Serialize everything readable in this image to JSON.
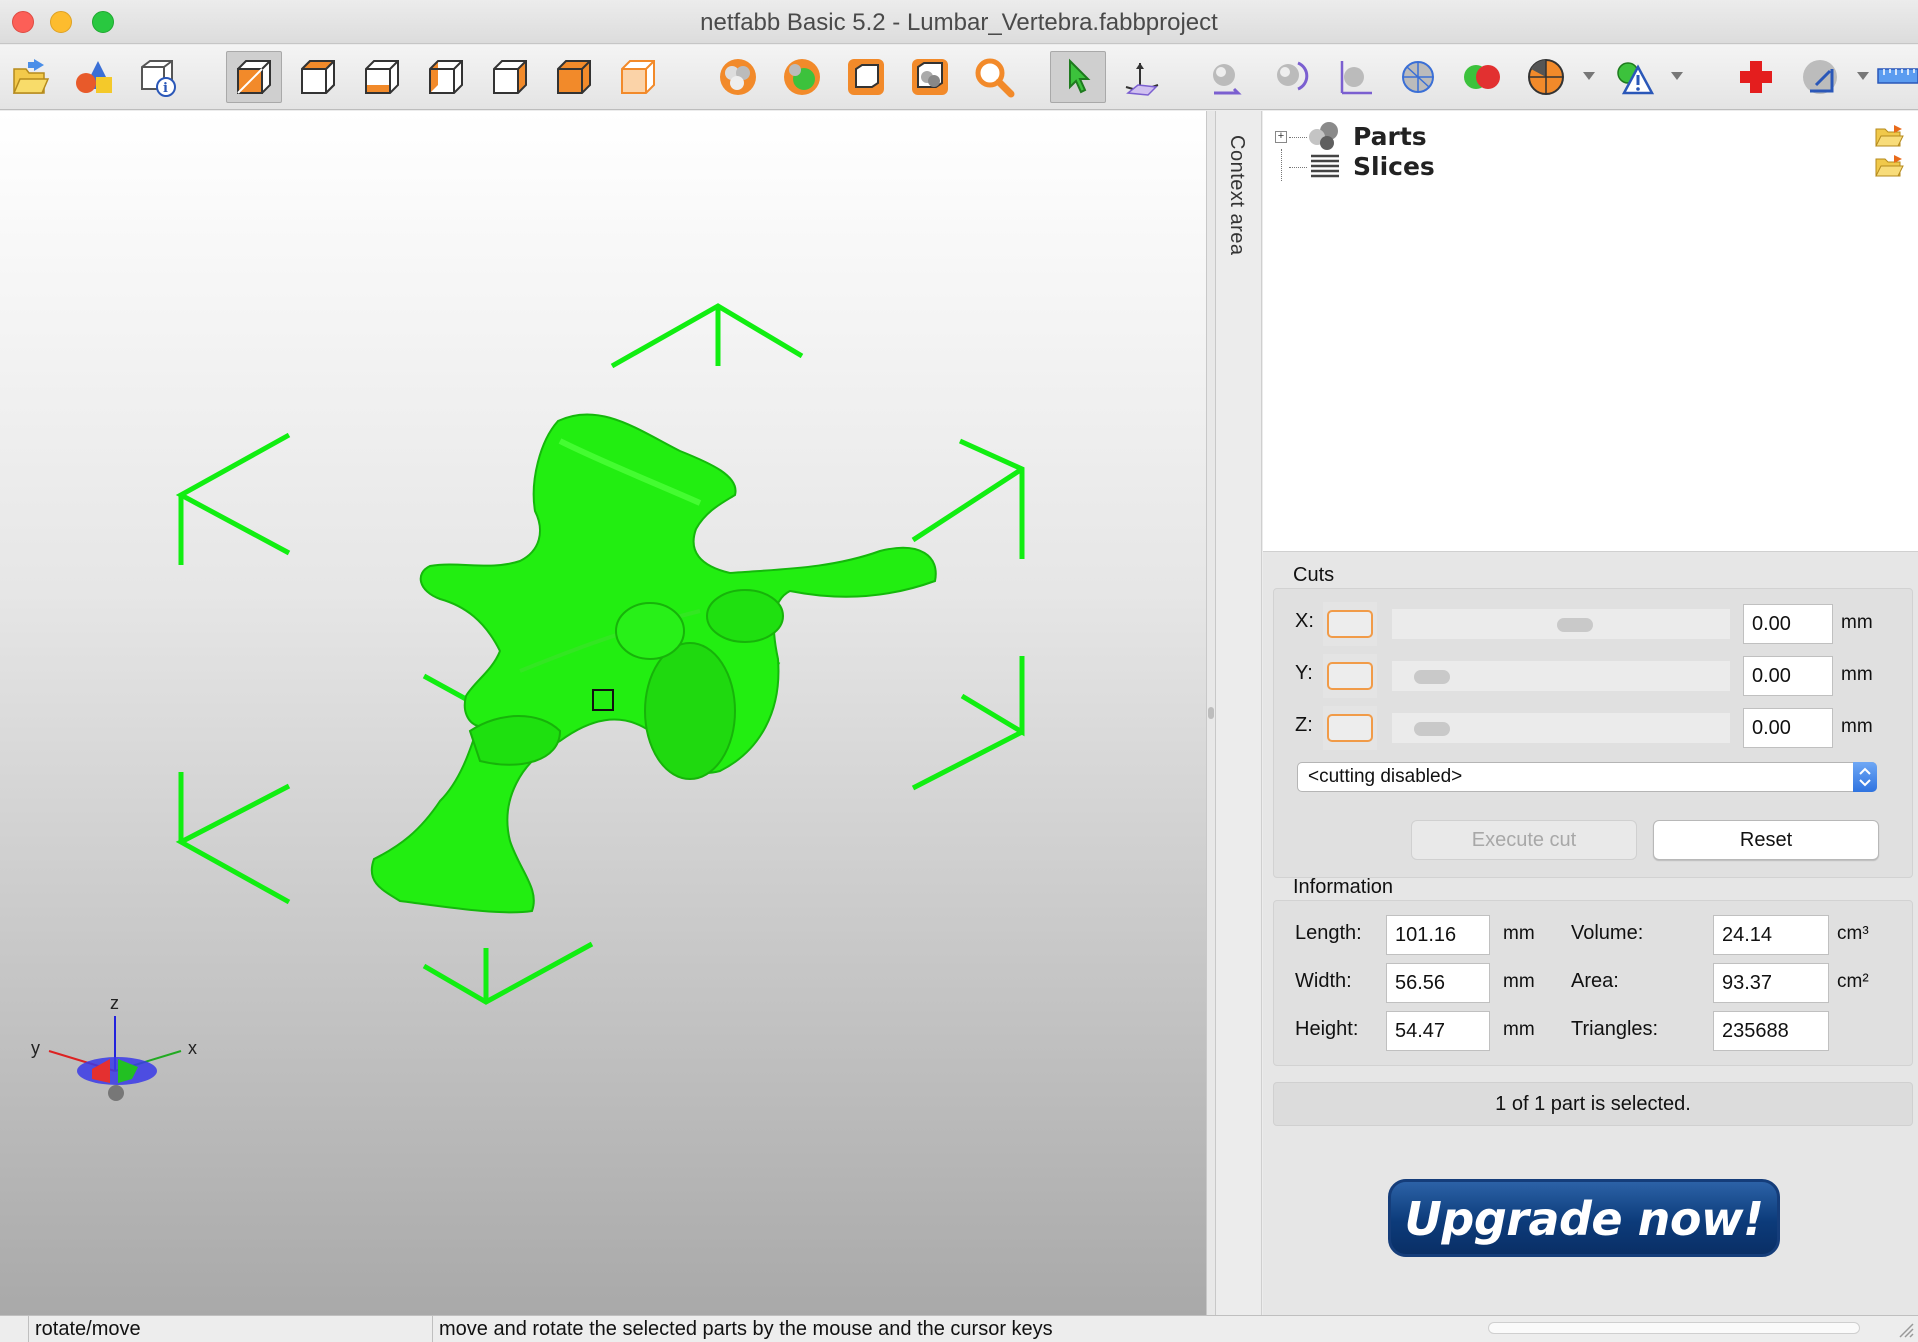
{
  "window": {
    "title": "netfabb Basic 5.2 - Lumbar_Vertebra.fabbproject"
  },
  "toolbar": {
    "buttons": [
      {
        "name": "open-project-button",
        "icon": "open-folder-icon"
      },
      {
        "name": "add-part-button",
        "icon": "shapes-icon"
      },
      {
        "name": "part-info-button",
        "icon": "info-box-icon"
      },
      {
        "name": "view-default-button",
        "icon": "cube-view-icon",
        "active": true
      },
      {
        "name": "view-front-button",
        "icon": "cube-front-icon"
      },
      {
        "name": "view-back-button",
        "icon": "cube-back-icon"
      },
      {
        "name": "view-left-button",
        "icon": "cube-left-icon"
      },
      {
        "name": "view-right-button",
        "icon": "cube-right-icon"
      },
      {
        "name": "view-top-button",
        "icon": "cube-top-icon"
      },
      {
        "name": "view-bottom-button",
        "icon": "cube-bottom-icon"
      },
      {
        "name": "zoom-all-button",
        "icon": "spheres-icon"
      },
      {
        "name": "zoom-selected-button",
        "icon": "sphere-green-icon"
      },
      {
        "name": "zoom-platform-button",
        "icon": "frame-icon"
      },
      {
        "name": "zoom-parts-button",
        "icon": "frame-spheres-icon"
      },
      {
        "name": "zoom-tool-button",
        "icon": "magnifier-icon"
      },
      {
        "name": "select-tool-button",
        "icon": "cursor-icon",
        "active": true
      },
      {
        "name": "move-tool-button",
        "icon": "axes-move-icon"
      },
      {
        "name": "translate-button",
        "icon": "sphere-arrow-icon"
      },
      {
        "name": "rotate-button",
        "icon": "sphere-rotate-icon"
      },
      {
        "name": "scale-button",
        "icon": "sphere-axes-icon"
      },
      {
        "name": "mesh-button",
        "icon": "sphere-mesh-icon"
      },
      {
        "name": "boolean-button",
        "icon": "spheres-boolean-icon"
      },
      {
        "name": "analysis-button",
        "icon": "pie-icon"
      },
      {
        "name": "repair-button",
        "icon": "warning-icon"
      },
      {
        "name": "new-repair-button",
        "icon": "red-cross-icon"
      },
      {
        "name": "measure-button",
        "icon": "measure-icon"
      },
      {
        "name": "ruler-button",
        "icon": "ruler-icon"
      }
    ]
  },
  "context": {
    "label": "Context area"
  },
  "tree": {
    "items": [
      {
        "label": "Parts",
        "icon": "parts-spheres-icon"
      },
      {
        "label": "Slices",
        "icon": "slices-stack-icon"
      }
    ]
  },
  "cuts": {
    "title": "Cuts",
    "axes": [
      {
        "label": "X:",
        "value": "0.00",
        "unit": "mm",
        "position": 0.55
      },
      {
        "label": "Y:",
        "value": "0.00",
        "unit": "mm",
        "position": 0.05
      },
      {
        "label": "Z:",
        "value": "0.00",
        "unit": "mm",
        "position": 0.05
      }
    ],
    "mode": "<cutting disabled>",
    "execute_label": "Execute cut",
    "reset_label": "Reset"
  },
  "information": {
    "title": "Information",
    "length_label": "Length:",
    "length_value": "101.16",
    "length_unit": "mm",
    "width_label": "Width:",
    "width_value": "56.56",
    "width_unit": "mm",
    "height_label": "Height:",
    "height_value": "54.47",
    "height_unit": "mm",
    "volume_label": "Volume:",
    "volume_value": "24.14",
    "volume_unit": "cm³",
    "area_label": "Area:",
    "area_value": "93.37",
    "area_unit": "cm²",
    "triangles_label": "Triangles:",
    "triangles_value": "235688"
  },
  "selection_status": "1 of 1 part is selected.",
  "upgrade_label": "Upgrade now!",
  "viewport": {
    "axis_labels": {
      "z": "z",
      "y": "y",
      "x": "x"
    },
    "model_color": "#22ee11",
    "bounding_box_color": "#11ee11"
  },
  "statusbar": {
    "mode": "rotate/move",
    "hint": "move and rotate the selected parts by the mouse and the cursor keys"
  }
}
